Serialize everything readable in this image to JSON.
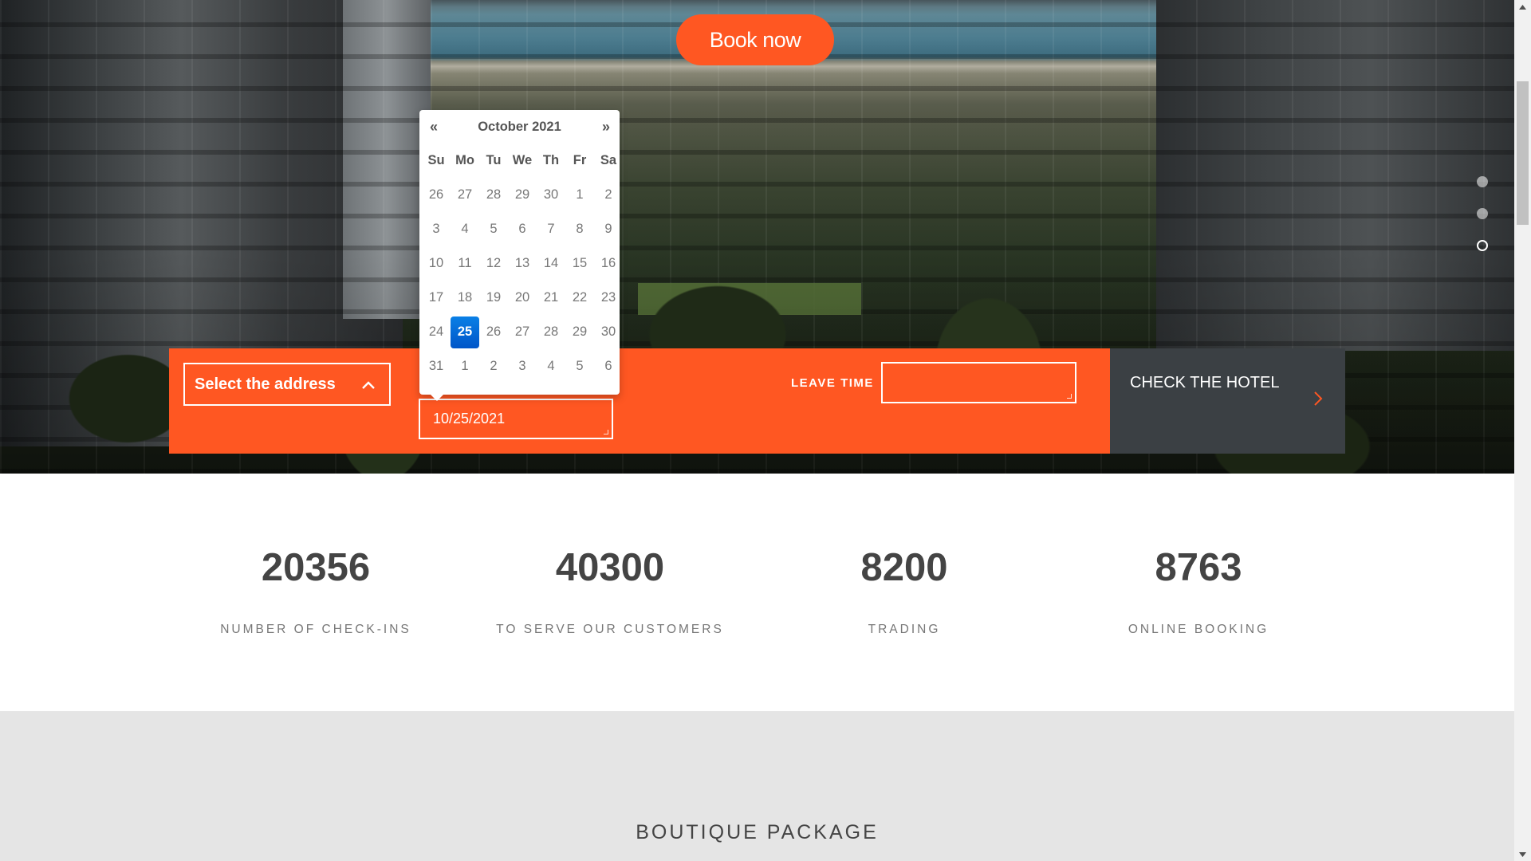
{
  "hero": {
    "book_now_label": "Book now",
    "slider_dots": [
      {
        "active": false
      },
      {
        "active": false
      },
      {
        "active": true
      }
    ]
  },
  "booking": {
    "address_select_label": "Select the address",
    "arrive_value": "10/25/2021",
    "leave_label": "LEAVE TIME",
    "leave_value": "",
    "check_hotel_label": "CHECK THE HOTEL"
  },
  "datepicker": {
    "prev_label": "«",
    "next_label": "»",
    "month_title": "October 2021",
    "weekdays": [
      "Su",
      "Mo",
      "Tu",
      "We",
      "Th",
      "Fr",
      "Sa"
    ],
    "weeks": [
      [
        "26",
        "27",
        "28",
        "29",
        "30",
        "1",
        "2"
      ],
      [
        "3",
        "4",
        "5",
        "6",
        "7",
        "8",
        "9"
      ],
      [
        "10",
        "11",
        "12",
        "13",
        "14",
        "15",
        "16"
      ],
      [
        "17",
        "18",
        "19",
        "20",
        "21",
        "22",
        "23"
      ],
      [
        "24",
        "25",
        "26",
        "27",
        "28",
        "29",
        "30"
      ],
      [
        "31",
        "1",
        "2",
        "3",
        "4",
        "5",
        "6"
      ]
    ],
    "selected_day": "25"
  },
  "stats": [
    {
      "number": "20356",
      "label": "NUMBER OF CHECK-INS"
    },
    {
      "number": "40300",
      "label": "TO SERVE OUR CUSTOMERS"
    },
    {
      "number": "8200",
      "label": "TRADING"
    },
    {
      "number": "8763",
      "label": "ONLINE BOOKING"
    }
  ],
  "boutique": {
    "heading": "BOUTIQUE PACKAGE"
  },
  "colors": {
    "accent": "#ff5722",
    "dark_panel": "#3b4044",
    "datepicker_active": "#0068d8",
    "section_gray": "#e5e5e5"
  },
  "icons": {
    "address_chevron": "chevron-up-icon",
    "check_hotel_arrow": "chevron-right-icon",
    "scroll_up": "triangle-up-icon",
    "scroll_down": "triangle-down-icon"
  }
}
